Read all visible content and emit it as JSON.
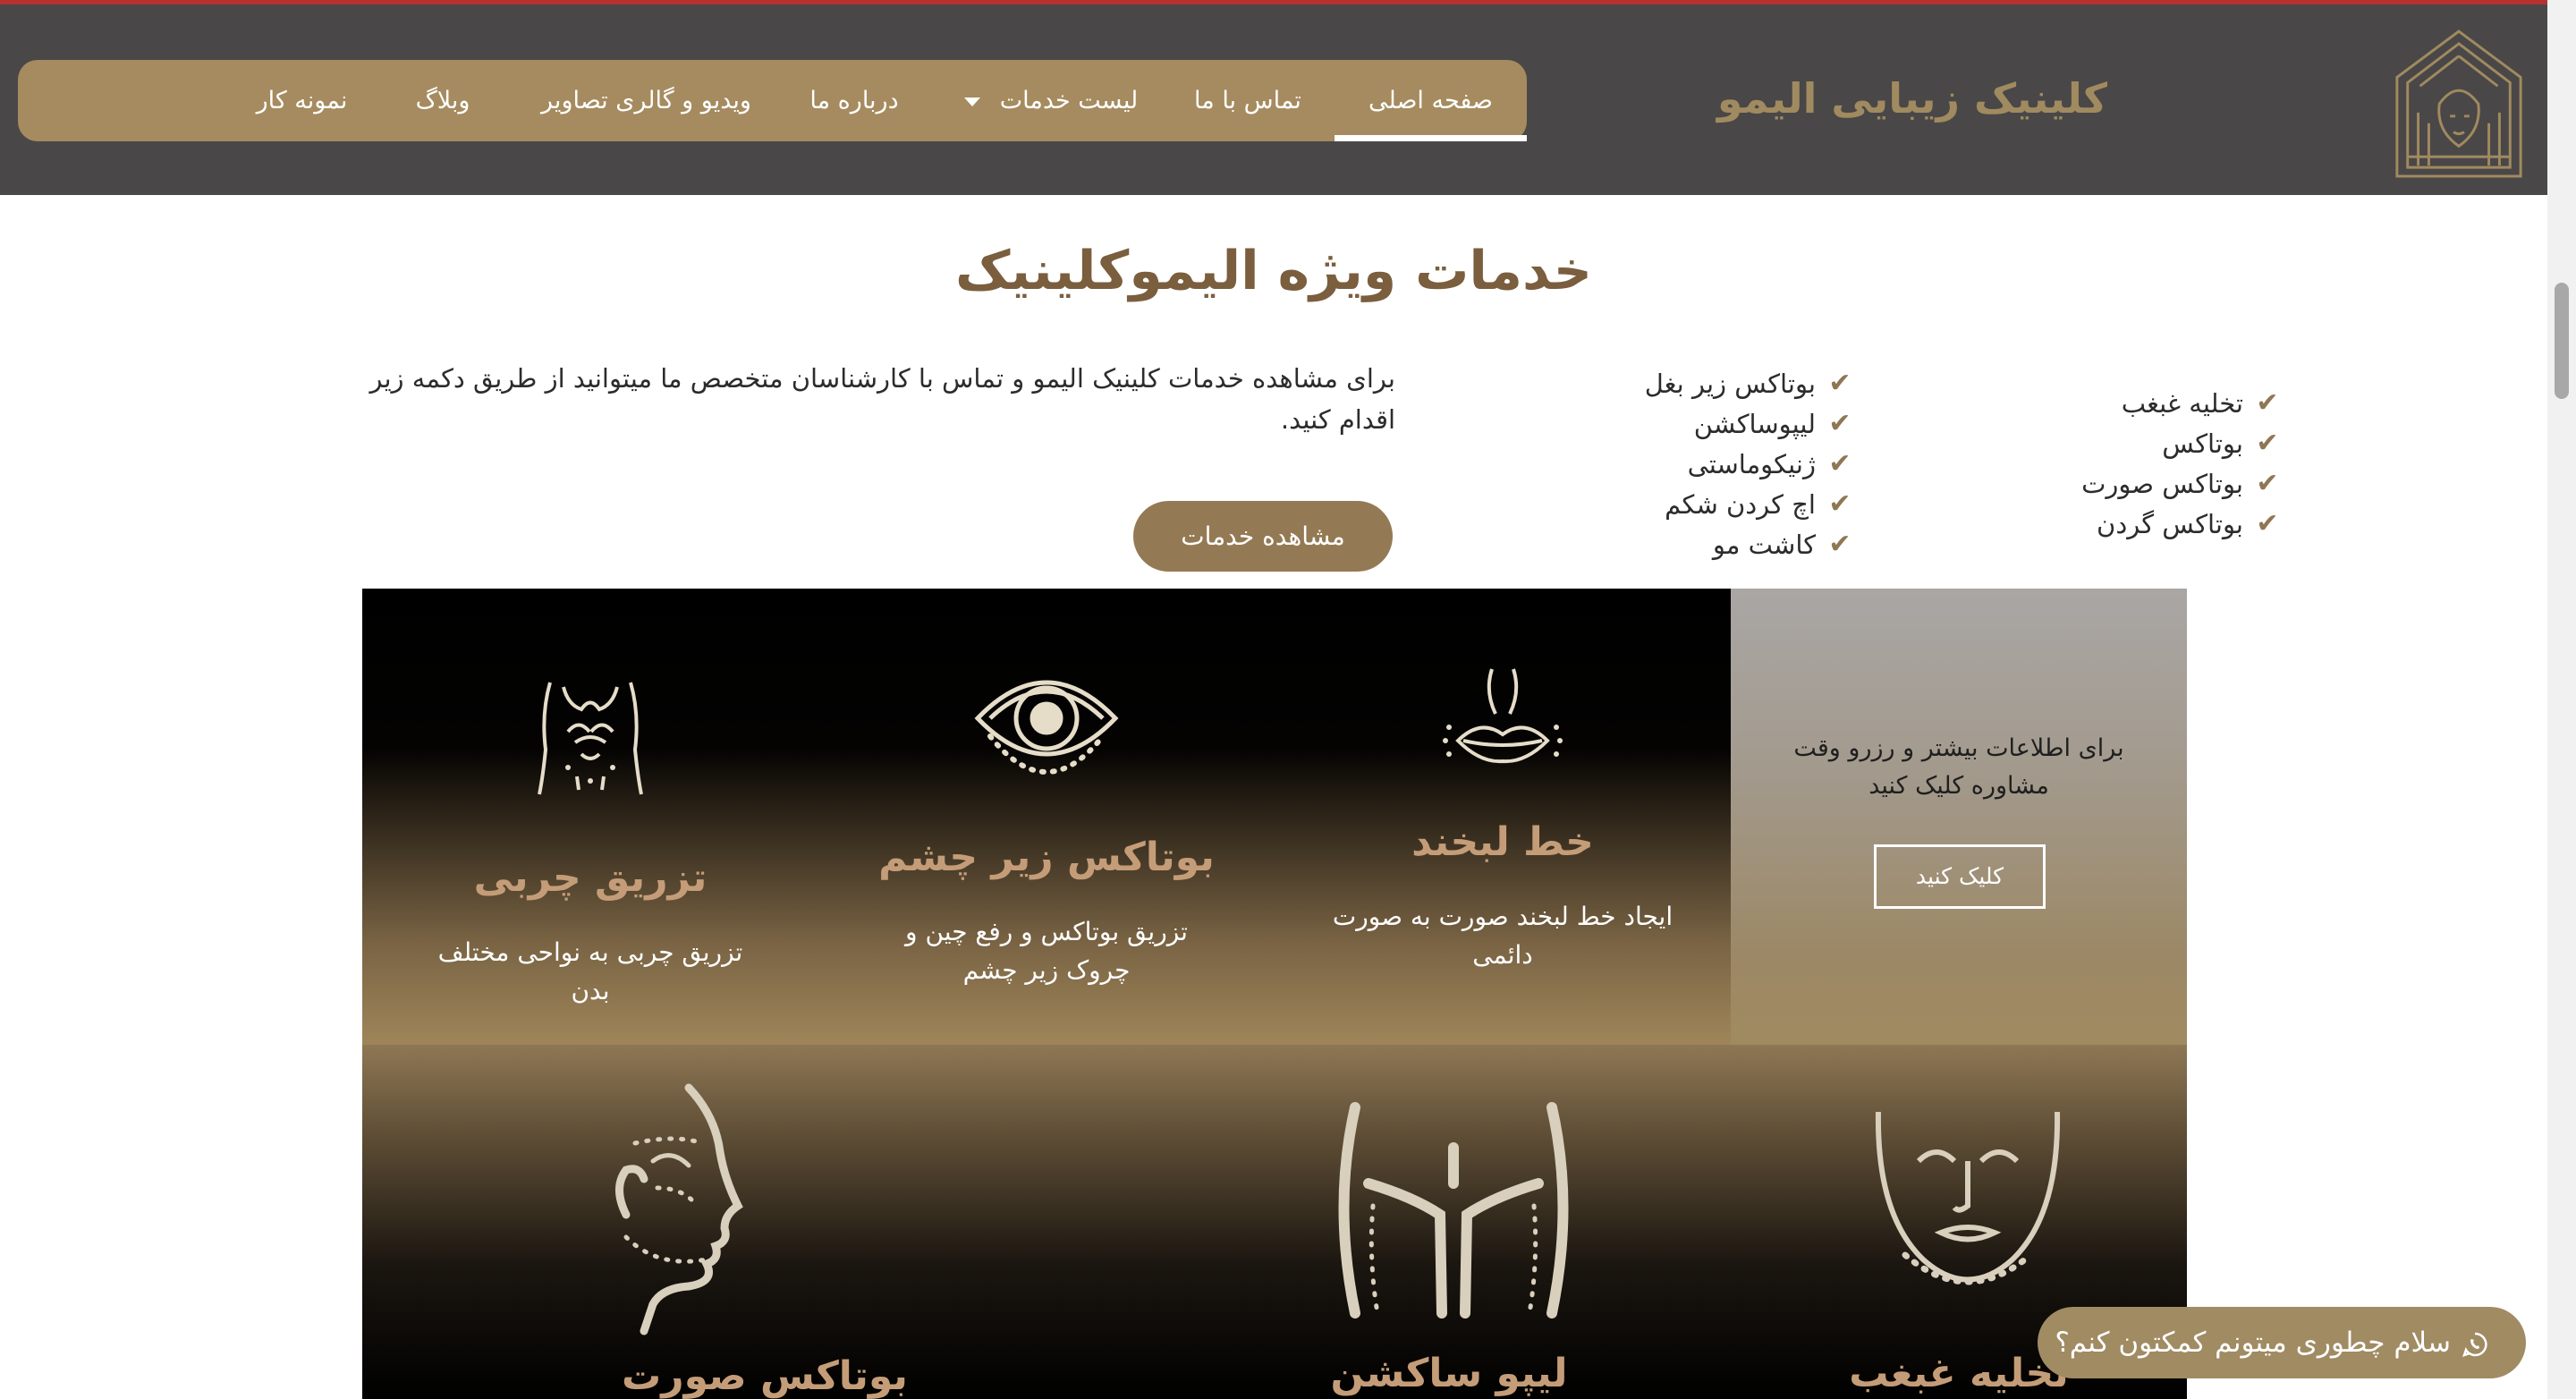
{
  "header": {
    "brand": "کلینیک زیبایی الیمو",
    "nav": [
      {
        "label": "صفحه اصلی",
        "active": true
      },
      {
        "label": "تماس با ما"
      },
      {
        "label": "لیست خدمات",
        "dropdown": true
      },
      {
        "label": "درباره ما"
      },
      {
        "label": "ویدیو و گالری تصاویر"
      },
      {
        "label": "وبلاگ"
      },
      {
        "label": "نمونه کار"
      }
    ]
  },
  "services": {
    "title": "خدمات ویژه الیموکلینیک",
    "list_right": [
      "تخلیه غبغب",
      "بوتاکس",
      "بوتاکس صورت",
      "بوتاکس گردن"
    ],
    "list_middle": [
      "بوتاکس زیر بغل",
      "لیپوساکشن",
      "ژنیکوماستی",
      "اچ کردن شکم",
      "کاشت مو"
    ],
    "intro": "برای مشاهده خدمات کلینیک الیمو و تماس با کارشناسان متخصص ما میتوانید از طریق دکمه زیر اقدام کنید.",
    "button": "مشاهده خدمات"
  },
  "promo": {
    "text": "برای اطلاعات بیشتر و رزرو وقت مشاوره کلیک کنید",
    "button": "کلیک کنید"
  },
  "tiles": [
    {
      "title": "خط لبخند",
      "desc": "ایجاد خط لبخند صورت به صورت دائمی",
      "icon": "lips-icon"
    },
    {
      "title": "بوتاکس زیر چشم",
      "desc": "تزریق بوتاکس و رفع چین و چروک زیر چشم",
      "icon": "eye-icon"
    },
    {
      "title": "تزریق چربی",
      "desc": "تزریق چربی به نواحی مختلف بدن",
      "icon": "body-torso-icon"
    },
    {
      "title": "تخلیه غبغب",
      "icon": "face-front-icon"
    },
    {
      "title": "لیپو ساکشن",
      "icon": "legs-icon"
    },
    {
      "title": "بوتاکس صورت",
      "icon": "face-profile-icon"
    }
  ],
  "chat": {
    "text": "سلام چطوری میتونم کمکتون کنم؟",
    "icon": "whatsapp-icon"
  },
  "colors": {
    "header_bg": "#4a4748",
    "nav_bg": "#a58b5f",
    "gold": "#a08a5f",
    "title_brown": "#7a5e3e",
    "tile_title": "#c49d78",
    "accent_red": "#b5322f"
  }
}
